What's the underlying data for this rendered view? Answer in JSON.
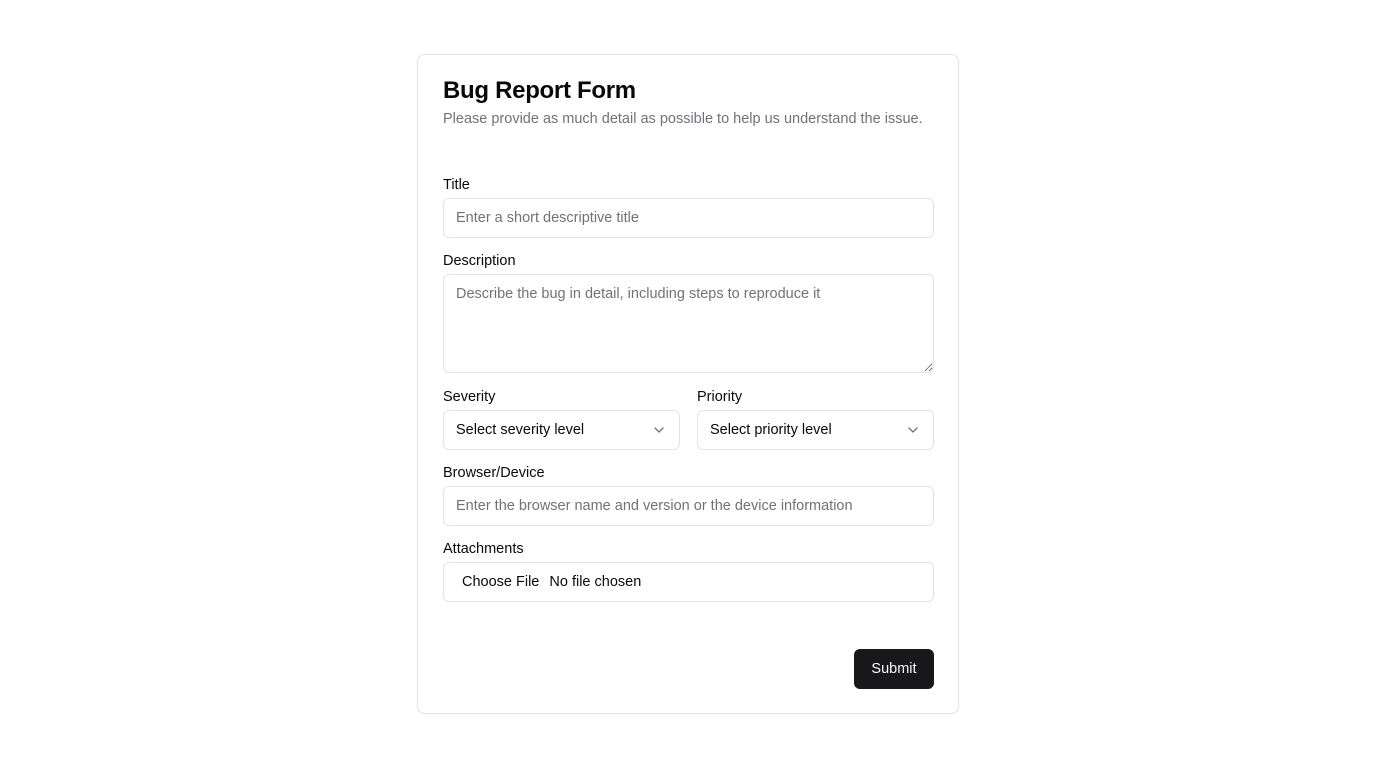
{
  "form": {
    "title": "Bug Report Form",
    "subtitle": "Please provide as much detail as possible to help us understand the issue.",
    "title_field": {
      "label": "Title",
      "placeholder": "Enter a short descriptive title",
      "value": ""
    },
    "description_field": {
      "label": "Description",
      "placeholder": "Describe the bug in detail, including steps to reproduce it",
      "value": ""
    },
    "severity_field": {
      "label": "Severity",
      "selected": "Select severity level"
    },
    "priority_field": {
      "label": "Priority",
      "selected": "Select priority level"
    },
    "browser_field": {
      "label": "Browser/Device",
      "placeholder": "Enter the browser name and version or the device information",
      "value": ""
    },
    "attachments_field": {
      "label": "Attachments",
      "button_label": "Choose File",
      "status": "No file chosen"
    },
    "submit_label": "Submit"
  },
  "icons": {
    "select_chevron": "chevron-down-icon"
  },
  "colors": {
    "primary_button": "#18181b",
    "border": "#e4e4e7",
    "muted_text": "#71717a"
  }
}
